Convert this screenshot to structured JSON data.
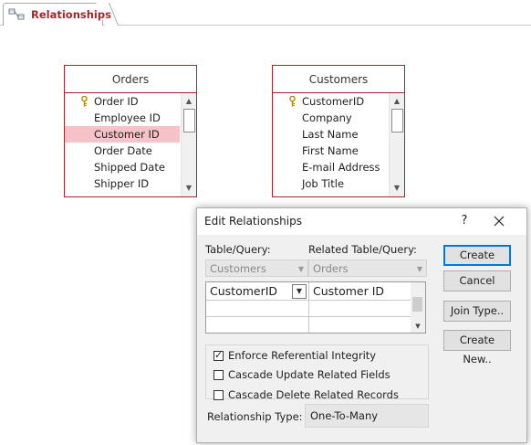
{
  "document_tab": {
    "label": "Relationships",
    "icon": "relationships-icon"
  },
  "tables": [
    {
      "title": "Orders",
      "fields": [
        {
          "name": "Order ID",
          "primary_key": true
        },
        {
          "name": "Employee ID",
          "primary_key": false
        },
        {
          "name": "Customer ID",
          "primary_key": false,
          "selected": true
        },
        {
          "name": "Order Date",
          "primary_key": false
        },
        {
          "name": "Shipped Date",
          "primary_key": false
        },
        {
          "name": "Shipper ID",
          "primary_key": false
        }
      ]
    },
    {
      "title": "Customers",
      "fields": [
        {
          "name": "CustomerID",
          "primary_key": true
        },
        {
          "name": "Company",
          "primary_key": false
        },
        {
          "name": "Last Name",
          "primary_key": false
        },
        {
          "name": "First Name",
          "primary_key": false
        },
        {
          "name": "E-mail Address",
          "primary_key": false
        },
        {
          "name": "Job Title",
          "primary_key": false
        }
      ]
    }
  ],
  "dialog": {
    "title": "Edit Relationships",
    "help_label": "?",
    "table_query_label": "Table/Query:",
    "related_table_query_label": "Related Table/Query:",
    "table_query_value": "Customers",
    "related_table_query_value": "Orders",
    "field_grid": {
      "left_field": "CustomerID",
      "right_field": "Customer ID"
    },
    "options": [
      {
        "label": "Enforce Referential Integrity",
        "checked": true
      },
      {
        "label": "Cascade Update Related Fields",
        "checked": false
      },
      {
        "label": "Cascade Delete Related Records",
        "checked": false
      }
    ],
    "relationship_type_label": "Relationship Type:",
    "relationship_type_value": "One-To-Many",
    "buttons": {
      "create": "Create",
      "cancel": "Cancel",
      "join_type": "Join Type..",
      "create_new": "Create New.."
    }
  },
  "colors": {
    "accent": "#a4262c",
    "selection": "#f4c2c7",
    "default_button": "#0078d7",
    "dialog_bg": "#f0f0f0"
  }
}
